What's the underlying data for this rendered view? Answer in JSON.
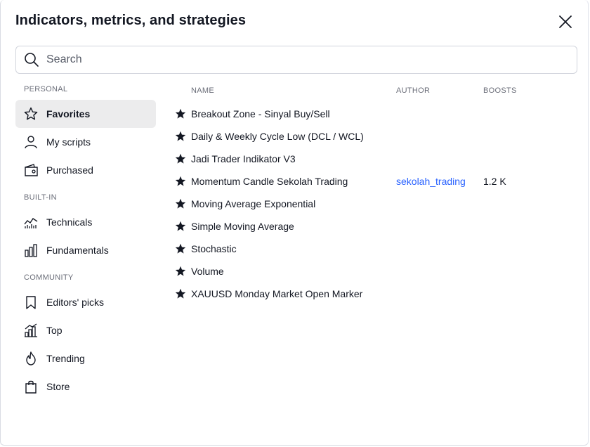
{
  "dialog": {
    "title": "Indicators, metrics, and strategies"
  },
  "search": {
    "placeholder": "Search",
    "value": ""
  },
  "sidebar": {
    "sections": [
      {
        "label": "PERSONAL",
        "items": [
          {
            "label": "Favorites",
            "icon": "star-outline-icon",
            "active": true
          },
          {
            "label": "My scripts",
            "icon": "user-icon"
          },
          {
            "label": "Purchased",
            "icon": "wallet-icon"
          }
        ]
      },
      {
        "label": "BUILT-IN",
        "items": [
          {
            "label": "Technicals",
            "icon": "chart-line-icon"
          },
          {
            "label": "Fundamentals",
            "icon": "bar-chart-icon"
          }
        ]
      },
      {
        "label": "COMMUNITY",
        "items": [
          {
            "label": "Editors' picks",
            "icon": "bookmark-icon"
          },
          {
            "label": "Top",
            "icon": "growth-chart-icon"
          },
          {
            "label": "Trending",
            "icon": "flame-icon"
          },
          {
            "label": "Store",
            "icon": "shopping-bag-icon"
          }
        ]
      }
    ]
  },
  "list": {
    "columns": {
      "name": "NAME",
      "author": "AUTHOR",
      "boosts": "BOOSTS"
    },
    "rows": [
      {
        "name": "Breakout Zone - Sinyal Buy/Sell",
        "author": "",
        "boosts": ""
      },
      {
        "name": "Daily & Weekly Cycle Low (DCL / WCL)",
        "author": "",
        "boosts": ""
      },
      {
        "name": "Jadi Trader Indikator V3",
        "author": "",
        "boosts": ""
      },
      {
        "name": "Momentum Candle Sekolah Trading",
        "author": "sekolah_trading",
        "boosts": "1.2 K"
      },
      {
        "name": "Moving Average Exponential",
        "author": "",
        "boosts": ""
      },
      {
        "name": "Simple Moving Average",
        "author": "",
        "boosts": ""
      },
      {
        "name": "Stochastic",
        "author": "",
        "boosts": ""
      },
      {
        "name": "Volume",
        "author": "",
        "boosts": ""
      },
      {
        "name": "XAUUSD Monday Market Open Marker",
        "author": "",
        "boosts": ""
      }
    ]
  },
  "colors": {
    "accent_link": "#2962ff",
    "active_bg": "#ececed",
    "text": "#131722",
    "muted": "#6a6d78"
  }
}
